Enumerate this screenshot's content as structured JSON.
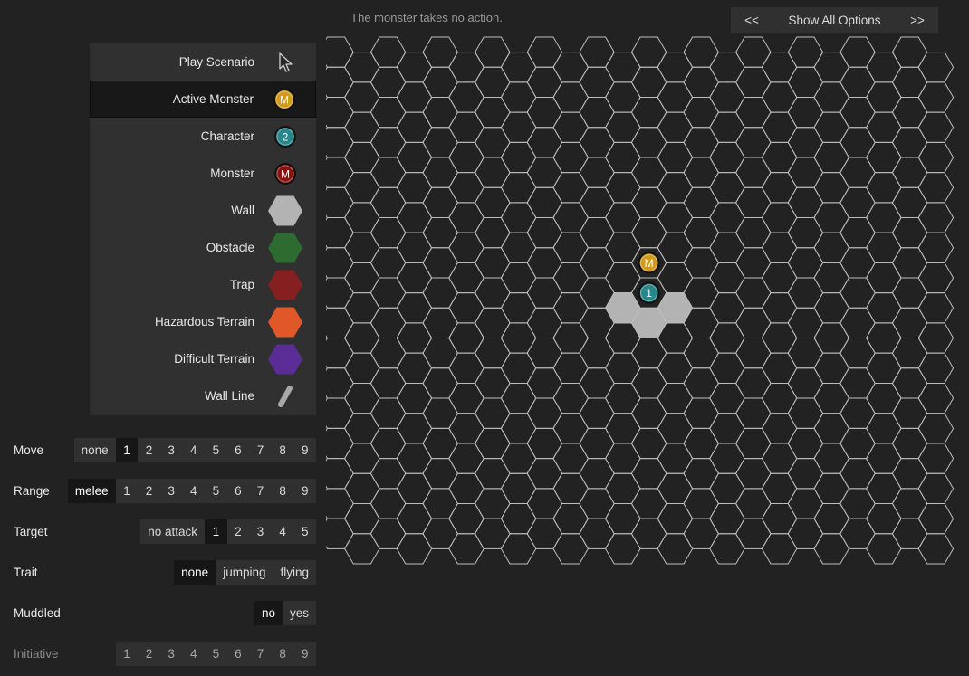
{
  "status_message": "The monster takes no action.",
  "top_nav": {
    "prev": "<<",
    "label": "Show All Options",
    "next": ">>"
  },
  "palette": [
    {
      "name": "play-scenario",
      "label": "Play Scenario",
      "icon": "cursor-icon",
      "active": false
    },
    {
      "name": "active-monster",
      "label": "Active Monster",
      "icon": "active-monster-token-icon",
      "token_text": "M",
      "active": true
    },
    {
      "name": "character",
      "label": "Character",
      "icon": "character-token-icon",
      "token_text": "2",
      "active": false
    },
    {
      "name": "monster",
      "label": "Monster",
      "icon": "monster-token-icon",
      "token_text": "M",
      "active": false
    },
    {
      "name": "wall",
      "label": "Wall",
      "icon": "wall-hex-icon",
      "active": false
    },
    {
      "name": "obstacle",
      "label": "Obstacle",
      "icon": "obstacle-hex-icon",
      "active": false
    },
    {
      "name": "trap",
      "label": "Trap",
      "icon": "trap-hex-icon",
      "active": false
    },
    {
      "name": "hazardous-terrain",
      "label": "Hazardous Terrain",
      "icon": "hazardous-terrain-hex-icon",
      "active": false
    },
    {
      "name": "difficult-terrain",
      "label": "Difficult Terrain",
      "icon": "difficult-terrain-hex-icon",
      "active": false
    },
    {
      "name": "wall-line",
      "label": "Wall Line",
      "icon": "wall-line-icon",
      "active": false
    }
  ],
  "controls": [
    {
      "name": "move",
      "label": "Move",
      "options": [
        "none",
        "1",
        "2",
        "3",
        "4",
        "5",
        "6",
        "7",
        "8",
        "9"
      ],
      "selected": "1"
    },
    {
      "name": "range",
      "label": "Range",
      "options": [
        "melee",
        "1",
        "2",
        "3",
        "4",
        "5",
        "6",
        "7",
        "8",
        "9"
      ],
      "selected": "melee"
    },
    {
      "name": "target",
      "label": "Target",
      "options": [
        "no attack",
        "1",
        "2",
        "3",
        "4",
        "5"
      ],
      "selected": "1"
    },
    {
      "name": "trait",
      "label": "Trait",
      "options": [
        "none",
        "jumping",
        "flying"
      ],
      "selected": "none"
    },
    {
      "name": "muddled",
      "label": "Muddled",
      "options": [
        "no",
        "yes"
      ],
      "selected": "no"
    },
    {
      "name": "initiative",
      "label": "Initiative",
      "options": [
        "1",
        "2",
        "3",
        "4",
        "5",
        "6",
        "7",
        "8",
        "9"
      ],
      "selected": null,
      "dimmed": true
    }
  ],
  "colors": {
    "background": "#222222",
    "panel": "#303030",
    "selected": "#161616",
    "grid_line": "#bdbdbd",
    "wall": "#b3b3b3",
    "obstacle": "#2e6b30",
    "trap": "#862020",
    "hazardous": "#e0582a",
    "difficult": "#5a2c96",
    "active_monster": "#d29a1a",
    "character": "#27878a",
    "monster": "#8c1212"
  },
  "board": {
    "columns": 24,
    "rows": 17,
    "walls": [
      [
        11,
        8
      ],
      [
        13,
        8
      ],
      [
        12,
        9
      ]
    ],
    "tokens": [
      {
        "type": "active-monster",
        "col": 12,
        "row": 7,
        "text": "M"
      },
      {
        "type": "character",
        "col": 12,
        "row": 8,
        "text": "1"
      }
    ]
  }
}
